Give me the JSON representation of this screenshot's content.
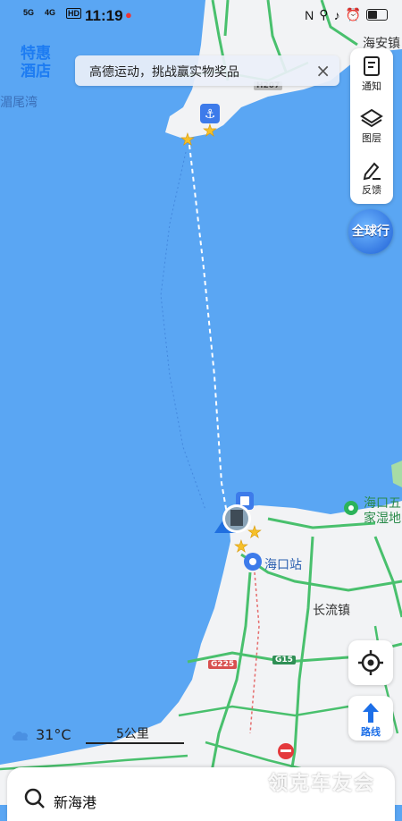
{
  "status_bar": {
    "time": "11:19",
    "network_left": "5G",
    "network_right": "4G",
    "hd_label": "HD"
  },
  "promo": {
    "line1": "特惠",
    "line2": "酒店"
  },
  "banner": {
    "text": "高德运动，挑战赢实物奖品",
    "close": "×"
  },
  "tools": [
    {
      "label": "通知",
      "icon": "notification-icon"
    },
    {
      "label": "图层",
      "icon": "layers-icon"
    },
    {
      "label": "反馈",
      "icon": "feedback-edit-icon"
    }
  ],
  "quanqiu_label": "全球行",
  "map_labels": {
    "top_right_town": "海安镇",
    "left_bay": "湄尾湾",
    "wetland_line1": "海口五",
    "wetland_line2": "家湿地",
    "station": "海口站",
    "town": "长流镇",
    "road_g225": "G225",
    "road_g15": "G15",
    "road_h": "H207"
  },
  "route_button_label": "路线",
  "weather": {
    "temperature": "31°C",
    "icon": "cloud-icon"
  },
  "scale_label": "5公里",
  "search": {
    "query": "新海港"
  },
  "watermark": "领克车友会",
  "colors": {
    "sea": "#5aa6f3",
    "land": "#f2f3f5",
    "road": "#49c06d",
    "accent": "#1d7cf2"
  }
}
